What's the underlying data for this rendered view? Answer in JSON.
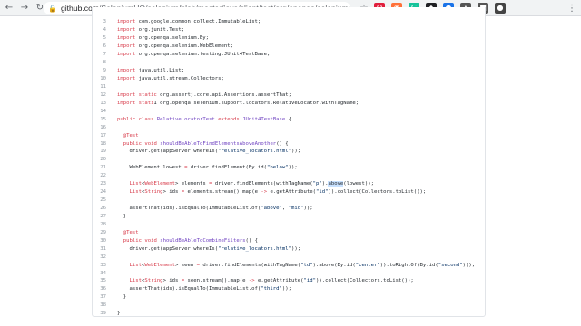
{
  "browser": {
    "url_host": "github.com",
    "url_path": "/SeleniumHQ/selenium/blob/master/java/client/test/org/openqa/selenium/support/locators/RelativeL...",
    "extensions": [
      {
        "name": "opera-extension-icon",
        "glyph": "O",
        "color": "#e01e3c"
      },
      {
        "name": "firefox-extension-icon",
        "glyph": "◉",
        "color": "#ff7139"
      },
      {
        "name": "grammarly-extension-icon",
        "glyph": "G",
        "color": "#15c39a"
      },
      {
        "name": "layers-extension-icon",
        "glyph": "◆",
        "color": "#202124"
      },
      {
        "name": "globe-extension-icon",
        "glyph": "●",
        "color": "#1a73e8"
      },
      {
        "name": "puzzle-extension-icon",
        "glyph": "▲",
        "color": "#555555"
      },
      {
        "name": "camera-extension-icon",
        "glyph": "■",
        "color": "#555555"
      },
      {
        "name": "circle-extension-icon",
        "glyph": "●",
        "color": "#444444"
      }
    ]
  },
  "code": {
    "lines": [
      {
        "n": "3",
        "segs": [
          {
            "c": "kw",
            "t": "import"
          },
          {
            "c": "",
            "t": " com.google.common.collect.ImmutableList;"
          }
        ]
      },
      {
        "n": "4",
        "segs": [
          {
            "c": "kw",
            "t": "import"
          },
          {
            "c": "",
            "t": " org.junit.Test;"
          }
        ]
      },
      {
        "n": "5",
        "segs": [
          {
            "c": "kw",
            "t": "import"
          },
          {
            "c": "",
            "t": " org.openqa.selenium.By;"
          }
        ]
      },
      {
        "n": "6",
        "segs": [
          {
            "c": "kw",
            "t": "import"
          },
          {
            "c": "",
            "t": " org.openqa.selenium.WebElement;"
          }
        ]
      },
      {
        "n": "7",
        "segs": [
          {
            "c": "kw",
            "t": "import"
          },
          {
            "c": "",
            "t": " org.openqa.selenium.testing.JUnit4TestBase;"
          }
        ]
      },
      {
        "n": "8",
        "segs": []
      },
      {
        "n": "9",
        "segs": [
          {
            "c": "kw",
            "t": "import"
          },
          {
            "c": "",
            "t": " java.util.List;"
          }
        ]
      },
      {
        "n": "10",
        "segs": [
          {
            "c": "kw",
            "t": "import"
          },
          {
            "c": "",
            "t": " java.util.stream.Collectors;"
          }
        ]
      },
      {
        "n": "11",
        "segs": []
      },
      {
        "n": "12",
        "segs": [
          {
            "c": "kw",
            "t": "import"
          },
          {
            "c": "",
            "t": " "
          },
          {
            "c": "kw",
            "t": "static"
          },
          {
            "c": "",
            "t": " org.assertj.core.api.Assertions.assertThat;"
          }
        ]
      },
      {
        "n": "13",
        "segs": [
          {
            "c": "kw",
            "t": "import"
          },
          {
            "c": "",
            "t": " "
          },
          {
            "c": "kw",
            "t": "stati"
          },
          {
            "c": "cursor",
            "t": "I"
          },
          {
            "c": "",
            "t": " org.openqa.selenium.support.locators.RelativeLocator.withTagName;"
          }
        ]
      },
      {
        "n": "14",
        "segs": []
      },
      {
        "n": "15",
        "segs": [
          {
            "c": "kw",
            "t": "public"
          },
          {
            "c": "",
            "t": " "
          },
          {
            "c": "kw",
            "t": "class"
          },
          {
            "c": "",
            "t": " "
          },
          {
            "c": "ty",
            "t": "RelativeLocatorTest"
          },
          {
            "c": "",
            "t": " "
          },
          {
            "c": "kw",
            "t": "extends"
          },
          {
            "c": "",
            "t": " "
          },
          {
            "c": "ty",
            "t": "JUnit4TestBase"
          },
          {
            "c": "",
            "t": " {"
          }
        ]
      },
      {
        "n": "16",
        "segs": []
      },
      {
        "n": "17",
        "segs": [
          {
            "c": "",
            "t": "  "
          },
          {
            "c": "kw",
            "t": "@Test"
          }
        ]
      },
      {
        "n": "18",
        "segs": [
          {
            "c": "",
            "t": "  "
          },
          {
            "c": "kw",
            "t": "public"
          },
          {
            "c": "",
            "t": " "
          },
          {
            "c": "kw",
            "t": "void"
          },
          {
            "c": "",
            "t": " "
          },
          {
            "c": "ty",
            "t": "shouldBeAbleToFindElementsAboveAnother"
          },
          {
            "c": "",
            "t": "() {"
          }
        ]
      },
      {
        "n": "19",
        "segs": [
          {
            "c": "",
            "t": "    driver.get(appServer.whereIs("
          },
          {
            "c": "st",
            "t": "\"relative_locators.html\""
          },
          {
            "c": "",
            "t": "));"
          }
        ]
      },
      {
        "n": "20",
        "segs": []
      },
      {
        "n": "21",
        "segs": [
          {
            "c": "",
            "t": "    WebElement lowest "
          },
          {
            "c": "kw",
            "t": "="
          },
          {
            "c": "",
            "t": " driver.findElement(By.id("
          },
          {
            "c": "st",
            "t": "\"below\""
          },
          {
            "c": "",
            "t": "));"
          }
        ]
      },
      {
        "n": "22",
        "segs": []
      },
      {
        "n": "23",
        "segs": [
          {
            "c": "",
            "t": "    "
          },
          {
            "c": "kw",
            "t": "List"
          },
          {
            "c": "",
            "t": "<"
          },
          {
            "c": "kw",
            "t": "WebElement"
          },
          {
            "c": "",
            "t": "> elements "
          },
          {
            "c": "kw",
            "t": "="
          },
          {
            "c": "",
            "t": " driver.findElements(withTagName("
          },
          {
            "c": "st",
            "t": "\"p\""
          },
          {
            "c": "",
            "t": ")."
          },
          {
            "c": "hl",
            "t": "above"
          },
          {
            "c": "",
            "t": "(lowest));"
          }
        ]
      },
      {
        "n": "24",
        "segs": [
          {
            "c": "",
            "t": "    "
          },
          {
            "c": "kw",
            "t": "List"
          },
          {
            "c": "",
            "t": "<"
          },
          {
            "c": "kw",
            "t": "String"
          },
          {
            "c": "",
            "t": "> ids "
          },
          {
            "c": "kw",
            "t": "="
          },
          {
            "c": "",
            "t": " elements.stream().map(e "
          },
          {
            "c": "kw",
            "t": "->"
          },
          {
            "c": "",
            "t": " e.getAttribute("
          },
          {
            "c": "st",
            "t": "\"id\""
          },
          {
            "c": "",
            "t": ")).collect(Collectors.toList());"
          }
        ]
      },
      {
        "n": "25",
        "segs": []
      },
      {
        "n": "26",
        "segs": [
          {
            "c": "",
            "t": "    assertThat(ids).isEqualTo(ImmutableList.of("
          },
          {
            "c": "st",
            "t": "\"above\""
          },
          {
            "c": "",
            "t": ", "
          },
          {
            "c": "st",
            "t": "\"mid\""
          },
          {
            "c": "",
            "t": "));"
          }
        ]
      },
      {
        "n": "27",
        "segs": [
          {
            "c": "",
            "t": "  }"
          }
        ]
      },
      {
        "n": "28",
        "segs": []
      },
      {
        "n": "29",
        "segs": [
          {
            "c": "",
            "t": "  "
          },
          {
            "c": "kw",
            "t": "@Test"
          }
        ]
      },
      {
        "n": "30",
        "segs": [
          {
            "c": "",
            "t": "  "
          },
          {
            "c": "kw",
            "t": "public"
          },
          {
            "c": "",
            "t": " "
          },
          {
            "c": "kw",
            "t": "void"
          },
          {
            "c": "",
            "t": " "
          },
          {
            "c": "ty",
            "t": "shouldBeAbleToCombineFilters"
          },
          {
            "c": "",
            "t": "() {"
          }
        ]
      },
      {
        "n": "31",
        "segs": [
          {
            "c": "",
            "t": "    driver.get(appServer.whereIs("
          },
          {
            "c": "st",
            "t": "\"relative_locators.html\""
          },
          {
            "c": "",
            "t": "));"
          }
        ]
      },
      {
        "n": "32",
        "segs": []
      },
      {
        "n": "33",
        "segs": [
          {
            "c": "",
            "t": "    "
          },
          {
            "c": "kw",
            "t": "List"
          },
          {
            "c": "",
            "t": "<"
          },
          {
            "c": "kw",
            "t": "WebElement"
          },
          {
            "c": "",
            "t": "> seen "
          },
          {
            "c": "kw",
            "t": "="
          },
          {
            "c": "",
            "t": " driver.findElements(withTagName("
          },
          {
            "c": "st",
            "t": "\"td\""
          },
          {
            "c": "",
            "t": ").above(By.id("
          },
          {
            "c": "st",
            "t": "\"center\""
          },
          {
            "c": "",
            "t": ")).toRightOf(By.id("
          },
          {
            "c": "st",
            "t": "\"second\""
          },
          {
            "c": "",
            "t": ")));"
          }
        ]
      },
      {
        "n": "34",
        "segs": []
      },
      {
        "n": "35",
        "segs": [
          {
            "c": "",
            "t": "    "
          },
          {
            "c": "kw",
            "t": "List"
          },
          {
            "c": "",
            "t": "<"
          },
          {
            "c": "kw",
            "t": "String"
          },
          {
            "c": "",
            "t": "> ids "
          },
          {
            "c": "kw",
            "t": "="
          },
          {
            "c": "",
            "t": " seen.stream().map(e "
          },
          {
            "c": "kw",
            "t": "->"
          },
          {
            "c": "",
            "t": " e.getAttribute("
          },
          {
            "c": "st",
            "t": "\"id\""
          },
          {
            "c": "",
            "t": ")).collect(Collectors.toList());"
          }
        ]
      },
      {
        "n": "36",
        "segs": [
          {
            "c": "",
            "t": "    assertThat(ids).isEqualTo(ImmutableList.of("
          },
          {
            "c": "st",
            "t": "\"third\""
          },
          {
            "c": "",
            "t": "));"
          }
        ]
      },
      {
        "n": "37",
        "segs": [
          {
            "c": "",
            "t": "  }"
          }
        ]
      },
      {
        "n": "38",
        "segs": []
      },
      {
        "n": "39",
        "segs": [
          {
            "c": "",
            "t": "}"
          }
        ]
      }
    ]
  }
}
